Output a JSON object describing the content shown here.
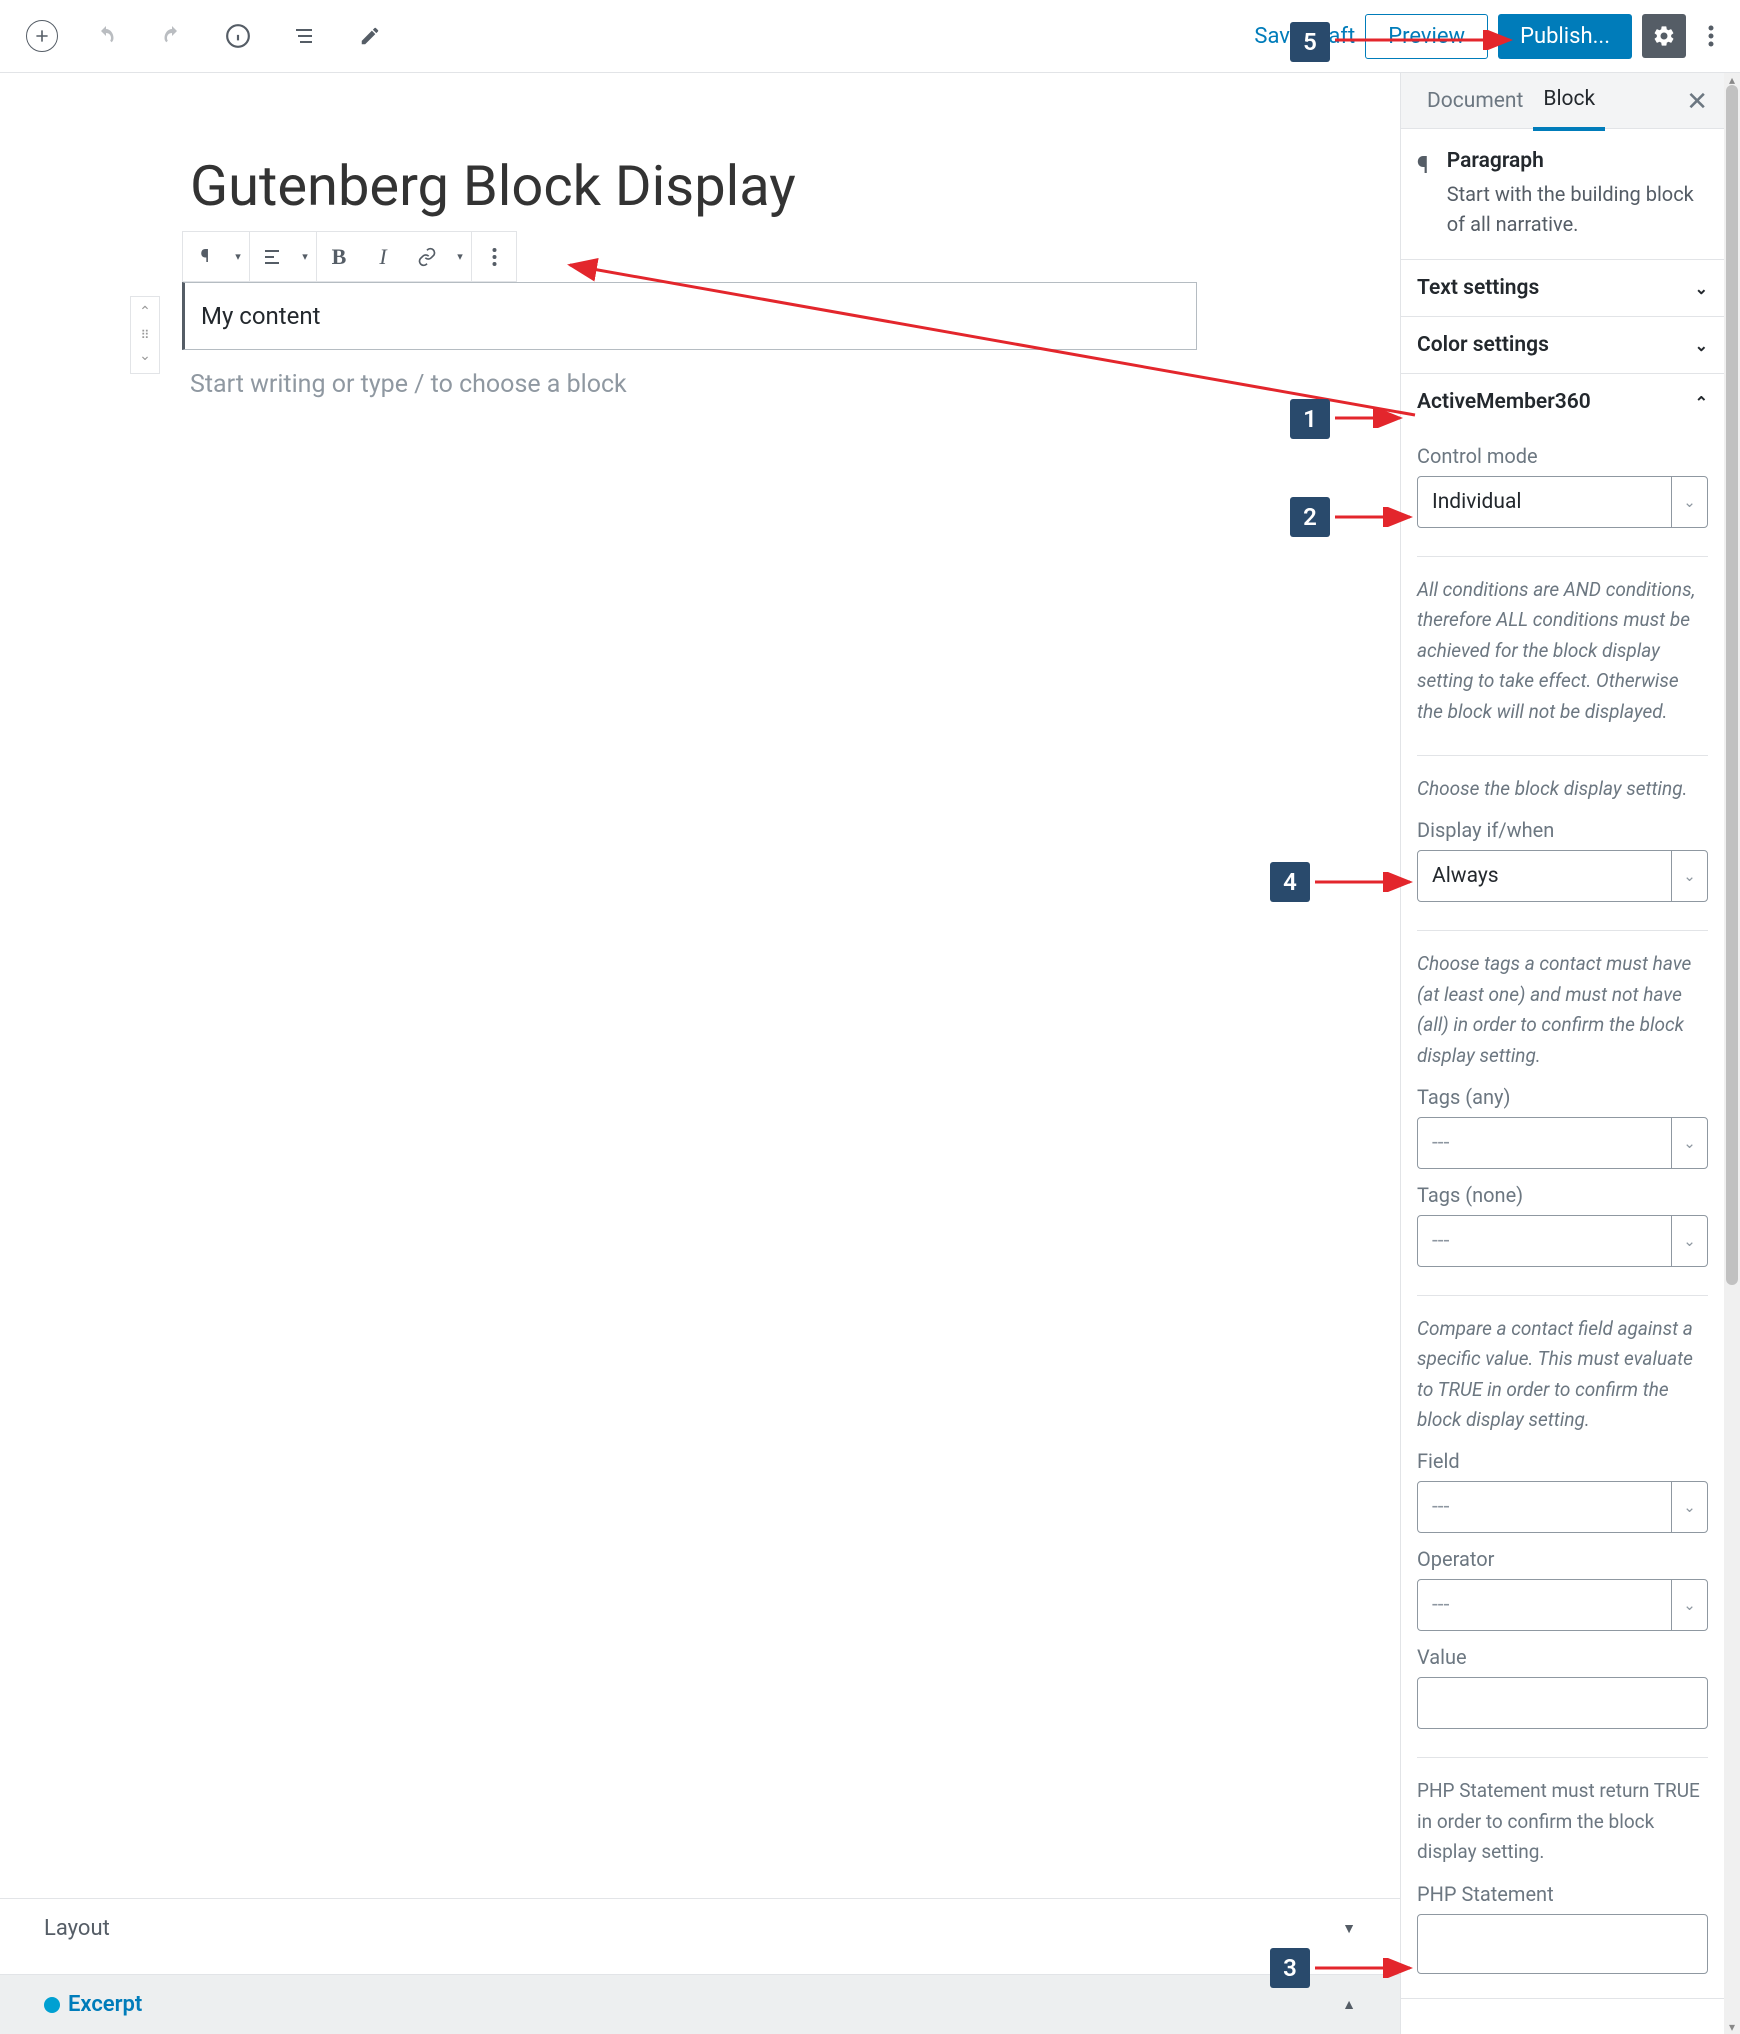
{
  "toolbar": {
    "save_draft": "Save Draft",
    "preview": "Preview",
    "publish": "Publish..."
  },
  "editor": {
    "title": "Gutenberg Block Display",
    "paragraph_content": "My content",
    "placeholder": "Start writing or type / to choose a block"
  },
  "bottomPanels": {
    "layout": "Layout",
    "excerpt": "Excerpt"
  },
  "sidebar": {
    "tabs": {
      "document": "Document",
      "block": "Block"
    },
    "block_info": {
      "name": "Paragraph",
      "description": "Start with the building block of all narrative."
    },
    "sections": {
      "text_settings": "Text settings",
      "color_settings": "Color settings",
      "active_member": "ActiveMember360"
    },
    "am360": {
      "control_mode_label": "Control mode",
      "control_mode_value": "Individual",
      "help_conditions": "All conditions are AND conditions, therefore ALL conditions must be achieved for the block display setting to take effect. Otherwise the block will not be displayed.",
      "help_display": "Choose the block display setting.",
      "display_label": "Display if/when",
      "display_value": "Always",
      "help_tags": "Choose tags a contact must have (at least one) and must not have (all) in order to confirm the block display setting.",
      "tags_any_label": "Tags (any)",
      "tags_none_label": "Tags (none)",
      "select_placeholder": "---",
      "help_field": "Compare a contact field against a specific value. This must evaluate to TRUE in order to confirm the block display setting.",
      "field_label": "Field",
      "operator_label": "Operator",
      "value_label": "Value",
      "help_php": "PHP Statement must return TRUE in order to confirm the block display setting.",
      "php_label": "PHP Statement"
    }
  },
  "callouts": {
    "1": "1",
    "2": "2",
    "3": "3",
    "4": "4",
    "5": "5"
  }
}
